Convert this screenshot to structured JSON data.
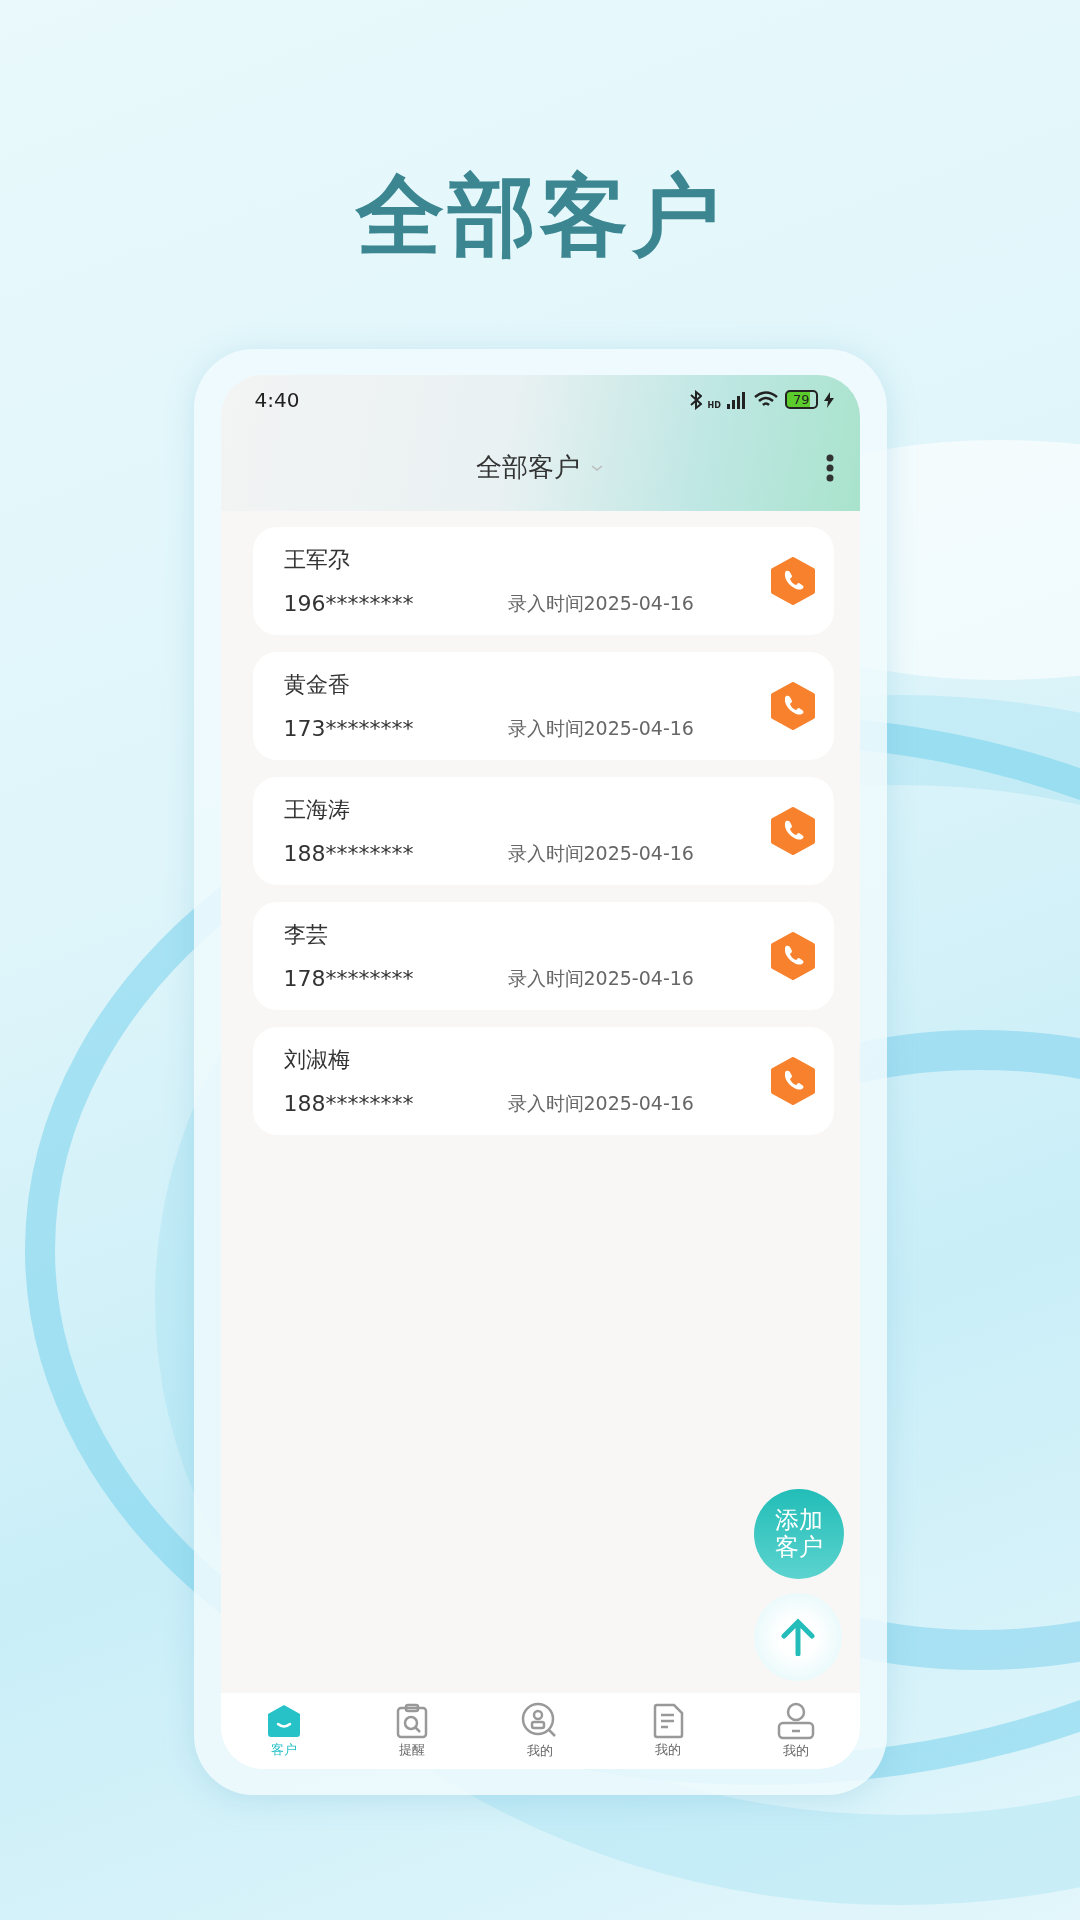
{
  "headline": "全部客户",
  "status_bar": {
    "time": "4:40",
    "network": "HD",
    "battery": "79"
  },
  "header": {
    "title": "全部客户"
  },
  "customers": [
    {
      "name": "王军尕",
      "phone": "196********",
      "entry_time": "录入时间2025-04-16"
    },
    {
      "name": "黄金香",
      "phone": "173********",
      "entry_time": "录入时间2025-04-16"
    },
    {
      "name": "王海涛",
      "phone": "188********",
      "entry_time": "录入时间2025-04-16"
    },
    {
      "name": "李芸",
      "phone": "178********",
      "entry_time": "录入时间2025-04-16"
    },
    {
      "name": "刘淑梅",
      "phone": "188********",
      "entry_time": "录入时间2025-04-16"
    }
  ],
  "add_button": {
    "label": "添加客户"
  },
  "bottom_nav": [
    {
      "kind": "home",
      "label": "客户",
      "selected": true
    },
    {
      "kind": "clipboard",
      "label": "提醒",
      "selected": false
    },
    {
      "kind": "search-person",
      "label": "我的",
      "selected": false
    },
    {
      "kind": "document",
      "label": "我的",
      "selected": false
    },
    {
      "kind": "person",
      "label": "我的",
      "selected": false
    }
  ]
}
